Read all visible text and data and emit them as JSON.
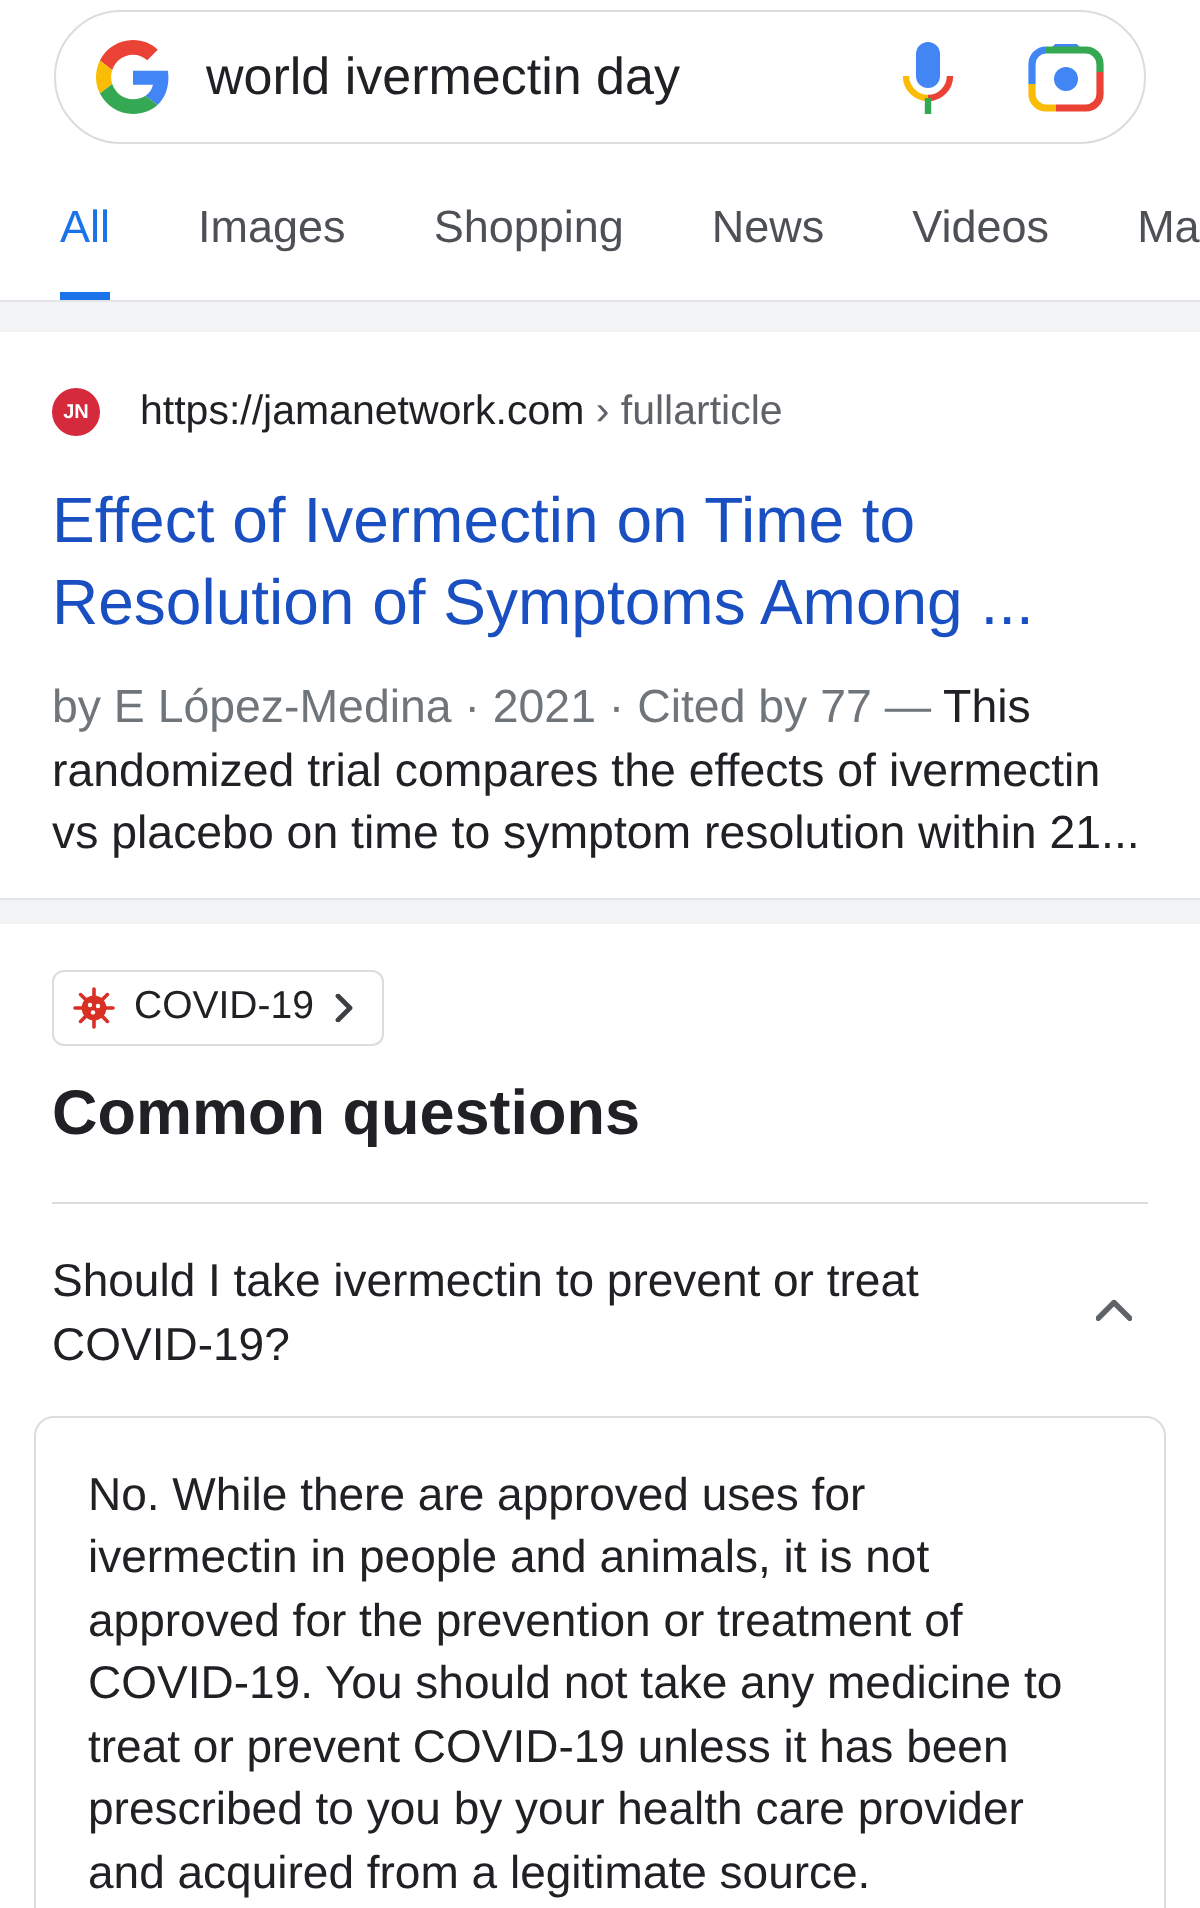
{
  "search": {
    "value": "world ivermectin day"
  },
  "tabs": [
    {
      "label": "All",
      "selected": true
    },
    {
      "label": "Images",
      "selected": false
    },
    {
      "label": "Shopping",
      "selected": false
    },
    {
      "label": "News",
      "selected": false
    },
    {
      "label": "Videos",
      "selected": false
    },
    {
      "label": "Ma",
      "selected": false
    }
  ],
  "result": {
    "favicon": "JN",
    "url": "https://jamanetwork.com",
    "breadcrumb": "› fullarticle",
    "title": "Effect of Ivermectin on Time to Resolution of Symptoms Among ...",
    "meta": "by E López-Medina · 2021 · Cited by 77 —",
    "snippet": "This randomized trial compares the effects of ivermectin vs placebo on time to symptom resolution within 21..."
  },
  "topic_chip": {
    "label": "COVID-19"
  },
  "common_questions": {
    "heading": "Common questions",
    "items": [
      {
        "question": "Should I take ivermectin to prevent or treat COVID-19?",
        "expanded": true,
        "answer": "No. While there are approved uses for ivermectin in people and animals, it is not approved for the prevention or treatment of COVID-19. You should not take any medicine to treat or prevent COVID-19 unless it has been prescribed to you by your health care provider and acquired from a legitimate source."
      }
    ]
  }
}
